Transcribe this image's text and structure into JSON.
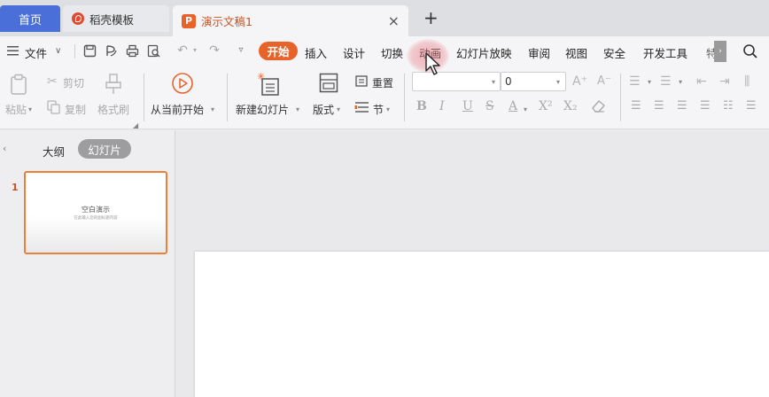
{
  "tabs": {
    "home": "首页",
    "daoke": "稻壳模板",
    "doc": "演示文稿1",
    "doc_logo": "P",
    "close": "×",
    "new_tab": "+"
  },
  "menu": {
    "file": "文件",
    "items": [
      "插入",
      "设计",
      "切换",
      "动画",
      "幻灯片放映",
      "审阅",
      "视图",
      "安全",
      "开发工具"
    ],
    "active": "开始",
    "truncated": "特",
    "accent": "#e8632a"
  },
  "ribbon": {
    "paste": "粘贴",
    "cut": "剪切",
    "copy": "复制",
    "format_painter": "格式刷",
    "play_from_current": "从当前开始",
    "new_slide": "新建幻灯片",
    "layout": "版式",
    "reset": "重置",
    "section": "节",
    "font_size_value": "0"
  },
  "leftpanel": {
    "outline_tab": "大纲",
    "slides_tab": "幻灯片",
    "slide_number": "1",
    "thumb_title": "空白演示",
    "thumb_subtitle": "在此输入您的副标题内容"
  }
}
